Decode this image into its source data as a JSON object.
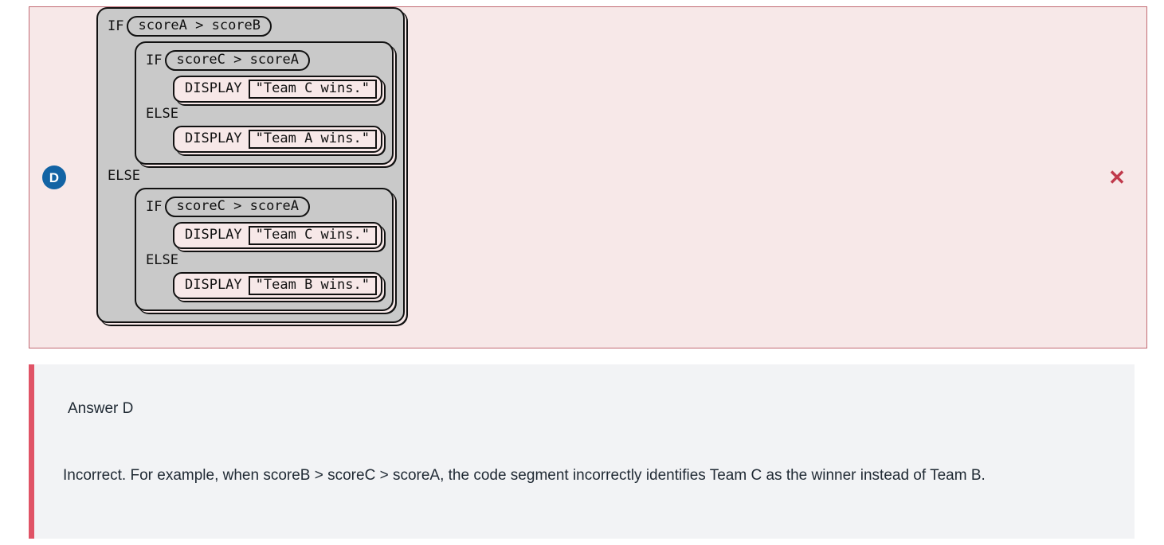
{
  "option": {
    "letter": "D",
    "result_icon": "cross-mark",
    "result_symbol": "✕",
    "accent_border": "#c26a73",
    "background": "#f7e8e8",
    "letter_badge_color": "#1263a4",
    "mark_color": "#c0394b"
  },
  "code": {
    "language_style": "block-based-pseudocode",
    "outer": {
      "keyword_if": "IF",
      "condition": "scoreA > scoreB",
      "keyword_else": "ELSE"
    },
    "if_branch": {
      "keyword_if": "IF",
      "condition": "scoreC > scoreA",
      "then_statement": {
        "keyword": "DISPLAY",
        "argument": "\"Team C wins.\""
      },
      "keyword_else": "ELSE",
      "else_statement": {
        "keyword": "DISPLAY",
        "argument": "\"Team A wins.\""
      }
    },
    "else_branch": {
      "keyword_if": "IF",
      "condition": "scoreC > scoreA",
      "then_statement": {
        "keyword": "DISPLAY",
        "argument": "\"Team C wins.\""
      },
      "keyword_else": "ELSE",
      "else_statement": {
        "keyword": "DISPLAY",
        "argument": "\"Team B wins.\""
      }
    }
  },
  "answer": {
    "title": "Answer D",
    "explanation": "Incorrect. For example, when scoreB > scoreC > scoreA, the code segment incorrectly identifies Team C as the winner instead of Team B.",
    "accent_bar_color": "#e05366",
    "panel_background": "#f2f3f5"
  }
}
